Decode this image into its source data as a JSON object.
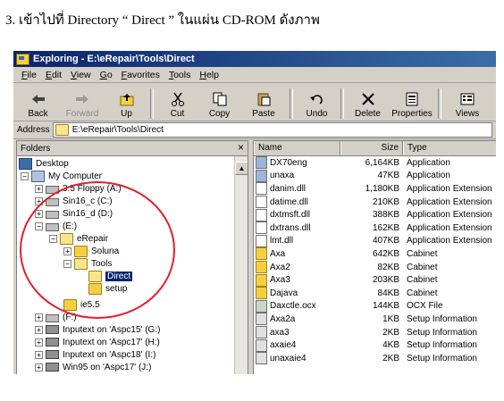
{
  "caption": "3. เข้าไปที่ Directory “ Direct ” ในแผ่น CD-ROM ดังภาพ",
  "window": {
    "title": "Exploring - E:\\eRepair\\Tools\\Direct",
    "menu": [
      "File",
      "Edit",
      "View",
      "Go",
      "Favorites",
      "Tools",
      "Help"
    ],
    "toolbar": [
      {
        "label": "Back",
        "icon": "back-arrow-icon",
        "enabled": true
      },
      {
        "label": "Forward",
        "icon": "forward-arrow-icon",
        "enabled": false
      },
      {
        "label": "Up",
        "icon": "up-folder-icon",
        "enabled": true
      },
      {
        "label": "Cut",
        "icon": "scissors-icon",
        "enabled": true
      },
      {
        "label": "Copy",
        "icon": "copy-icon",
        "enabled": true
      },
      {
        "label": "Paste",
        "icon": "paste-icon",
        "enabled": true
      },
      {
        "label": "Undo",
        "icon": "undo-icon",
        "enabled": true
      },
      {
        "label": "Delete",
        "icon": "delete-x-icon",
        "enabled": true
      },
      {
        "label": "Properties",
        "icon": "properties-icon",
        "enabled": true
      },
      {
        "label": "Views",
        "icon": "views-icon",
        "enabled": true
      }
    ],
    "address": {
      "label": "Address",
      "value": "E:\\eRepair\\Tools\\Direct"
    },
    "folders": {
      "header": "Folders",
      "close": "×",
      "tree": [
        {
          "label": "Desktop",
          "icon": "desktop"
        },
        {
          "label": "My Computer",
          "icon": "computer"
        },
        {
          "label": "3.5 Floppy (A:)",
          "icon": "drive"
        },
        {
          "label": "Sin16_c (C:)",
          "icon": "drive"
        },
        {
          "label": "Sin16_d (D:)",
          "icon": "drive"
        },
        {
          "label": "(E:)",
          "icon": "cdrom"
        },
        {
          "label": "eRepair",
          "icon": "folder-open"
        },
        {
          "label": "Soluna",
          "icon": "folder"
        },
        {
          "label": "Tools",
          "icon": "folder-open"
        },
        {
          "label": "Direct",
          "icon": "folder-open",
          "selected": true
        },
        {
          "label": "setup",
          "icon": "folder"
        },
        {
          "label": "ie5.5",
          "icon": "folder"
        },
        {
          "label": "(F:)",
          "icon": "cdrom"
        },
        {
          "label": "Inputext on 'Aspc15' (G:)",
          "icon": "network-drive"
        },
        {
          "label": "Inputext on 'Aspc17' (H:)",
          "icon": "network-drive"
        },
        {
          "label": "Inputext on 'Aspc18' (I:)",
          "icon": "network-drive"
        },
        {
          "label": "Win95 on 'Aspc17' (J:)",
          "icon": "network-drive"
        }
      ]
    },
    "files": {
      "columns": [
        "Name",
        "Size",
        "Type"
      ],
      "rows": [
        {
          "name": "DX70eng",
          "size": "6,164KB",
          "type": "Application",
          "icon": "exe"
        },
        {
          "name": "unaxa",
          "size": "47KB",
          "type": "Application",
          "icon": "exe"
        },
        {
          "name": "danim.dll",
          "size": "1,180KB",
          "type": "Application Extension",
          "icon": "dll"
        },
        {
          "name": "datime.dll",
          "size": "210KB",
          "type": "Application Extension",
          "icon": "dll"
        },
        {
          "name": "dxtmsft.dll",
          "size": "388KB",
          "type": "Application Extension",
          "icon": "dll"
        },
        {
          "name": "dxtrans.dll",
          "size": "162KB",
          "type": "Application Extension",
          "icon": "dll"
        },
        {
          "name": "lmt.dll",
          "size": "407KB",
          "type": "Application Extension",
          "icon": "dll"
        },
        {
          "name": "Axa",
          "size": "642KB",
          "type": "Cabinet",
          "icon": "cab"
        },
        {
          "name": "Axa2",
          "size": "82KB",
          "type": "Cabinet",
          "icon": "cab"
        },
        {
          "name": "Axa3",
          "size": "203KB",
          "type": "Cabinet",
          "icon": "cab"
        },
        {
          "name": "Dajava",
          "size": "84KB",
          "type": "Cabinet",
          "icon": "cab"
        },
        {
          "name": "Daxctle.ocx",
          "size": "144KB",
          "type": "OCX File",
          "icon": "ocx"
        },
        {
          "name": "Axa2a",
          "size": "1KB",
          "type": "Setup Information",
          "icon": "inf"
        },
        {
          "name": "axa3",
          "size": "2KB",
          "type": "Setup Information",
          "icon": "inf"
        },
        {
          "name": "axaie4",
          "size": "4KB",
          "type": "Setup Information",
          "icon": "inf"
        },
        {
          "name": "unaxaie4",
          "size": "2KB",
          "type": "Setup Information",
          "icon": "inf"
        }
      ]
    }
  },
  "annotation_color": "#e0202a"
}
